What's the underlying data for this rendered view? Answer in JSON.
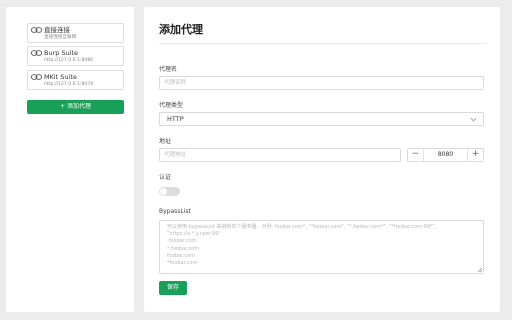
{
  "sidebar": {
    "proxies": [
      {
        "name": "直接连接",
        "address": "直接连接互联网"
      },
      {
        "name": "Burp Suite",
        "address": "http://127.0.0.1:8080"
      },
      {
        "name": "MKit Suite",
        "address": "http://127.0.0.1:8078"
      }
    ],
    "add_label": "+ 添加代理",
    "link_icon": "link-icon"
  },
  "main": {
    "title": "添加代理",
    "name_field": {
      "label": "代理名",
      "placeholder": "代理名称",
      "value": ""
    },
    "type_field": {
      "label": "代理类型",
      "value": "HTTP",
      "icon": "chevron-down-icon"
    },
    "address_field": {
      "label": "地址",
      "placeholder": "代理地址",
      "value": "",
      "port": "8080",
      "minus": "−",
      "plus": "+"
    },
    "auth": {
      "label": "认证",
      "enabled": false
    },
    "bypass": {
      "label": "BypassList",
      "lines": [
        "可以使用 bypassList 来跳转向个服务器。示例: foobar.com*, \"*foobar.com\", \"*.foobar.com*\", \"*foobar.com:99*\",",
        "\"https://x.*.y.com:99\"",
        ".foobar.com",
        "*.foobar.com",
        "foobar.com",
        "*foobar.com"
      ]
    },
    "save_label": "保存"
  },
  "colors": {
    "accent": "#18a058",
    "border": "#d9d9d9",
    "background": "#ececec"
  }
}
